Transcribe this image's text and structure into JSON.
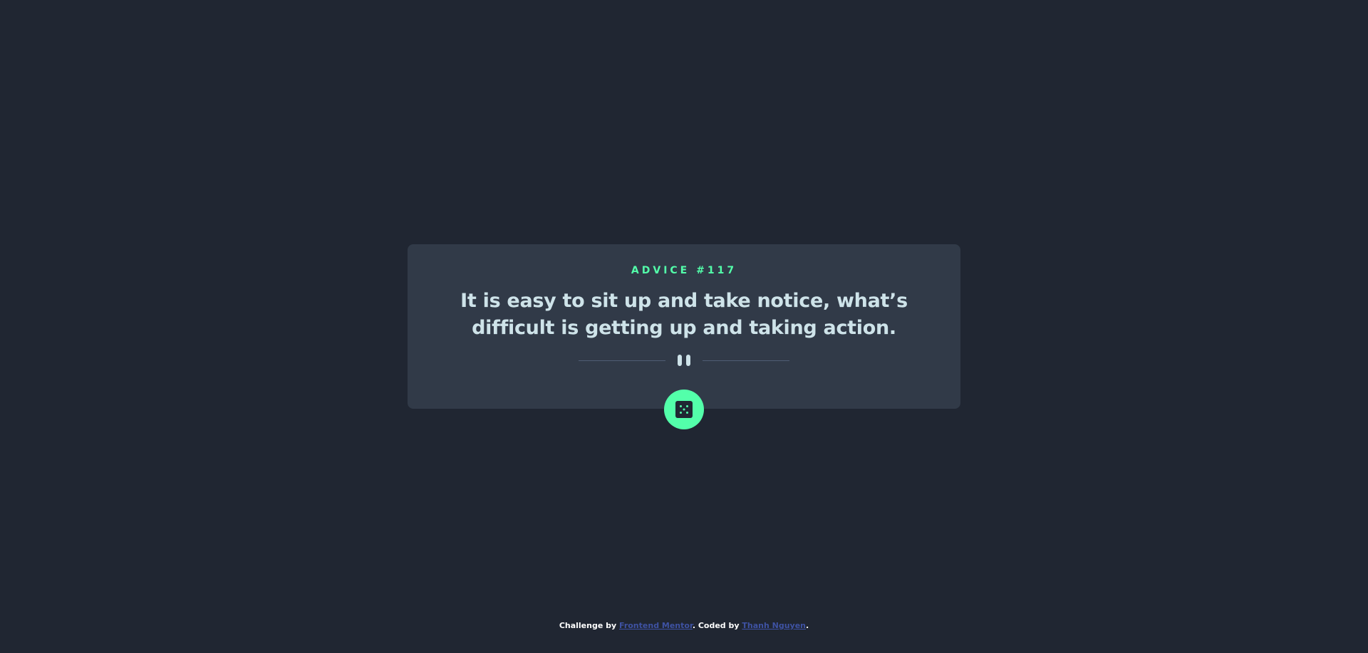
{
  "card": {
    "advice_label": "ADVICE #117",
    "quote": "It is easy to sit up and take notice, what’s difficult is getting up and taking action."
  },
  "divider": {
    "icon": "pause-icon"
  },
  "dice_button": {
    "icon": "dice-icon"
  },
  "footer": {
    "prefix": "Challenge by ",
    "challenge_link": "Frontend Mentor",
    "middle": ". Coded by ",
    "author_link": "Thanh Nguyen",
    "suffix": "."
  },
  "colors": {
    "background": "#202632",
    "card": "#313a48",
    "accent": "#53ffaa",
    "text": "#cee3e9",
    "divider": "#4f5d74",
    "link": "#3e52a3"
  }
}
